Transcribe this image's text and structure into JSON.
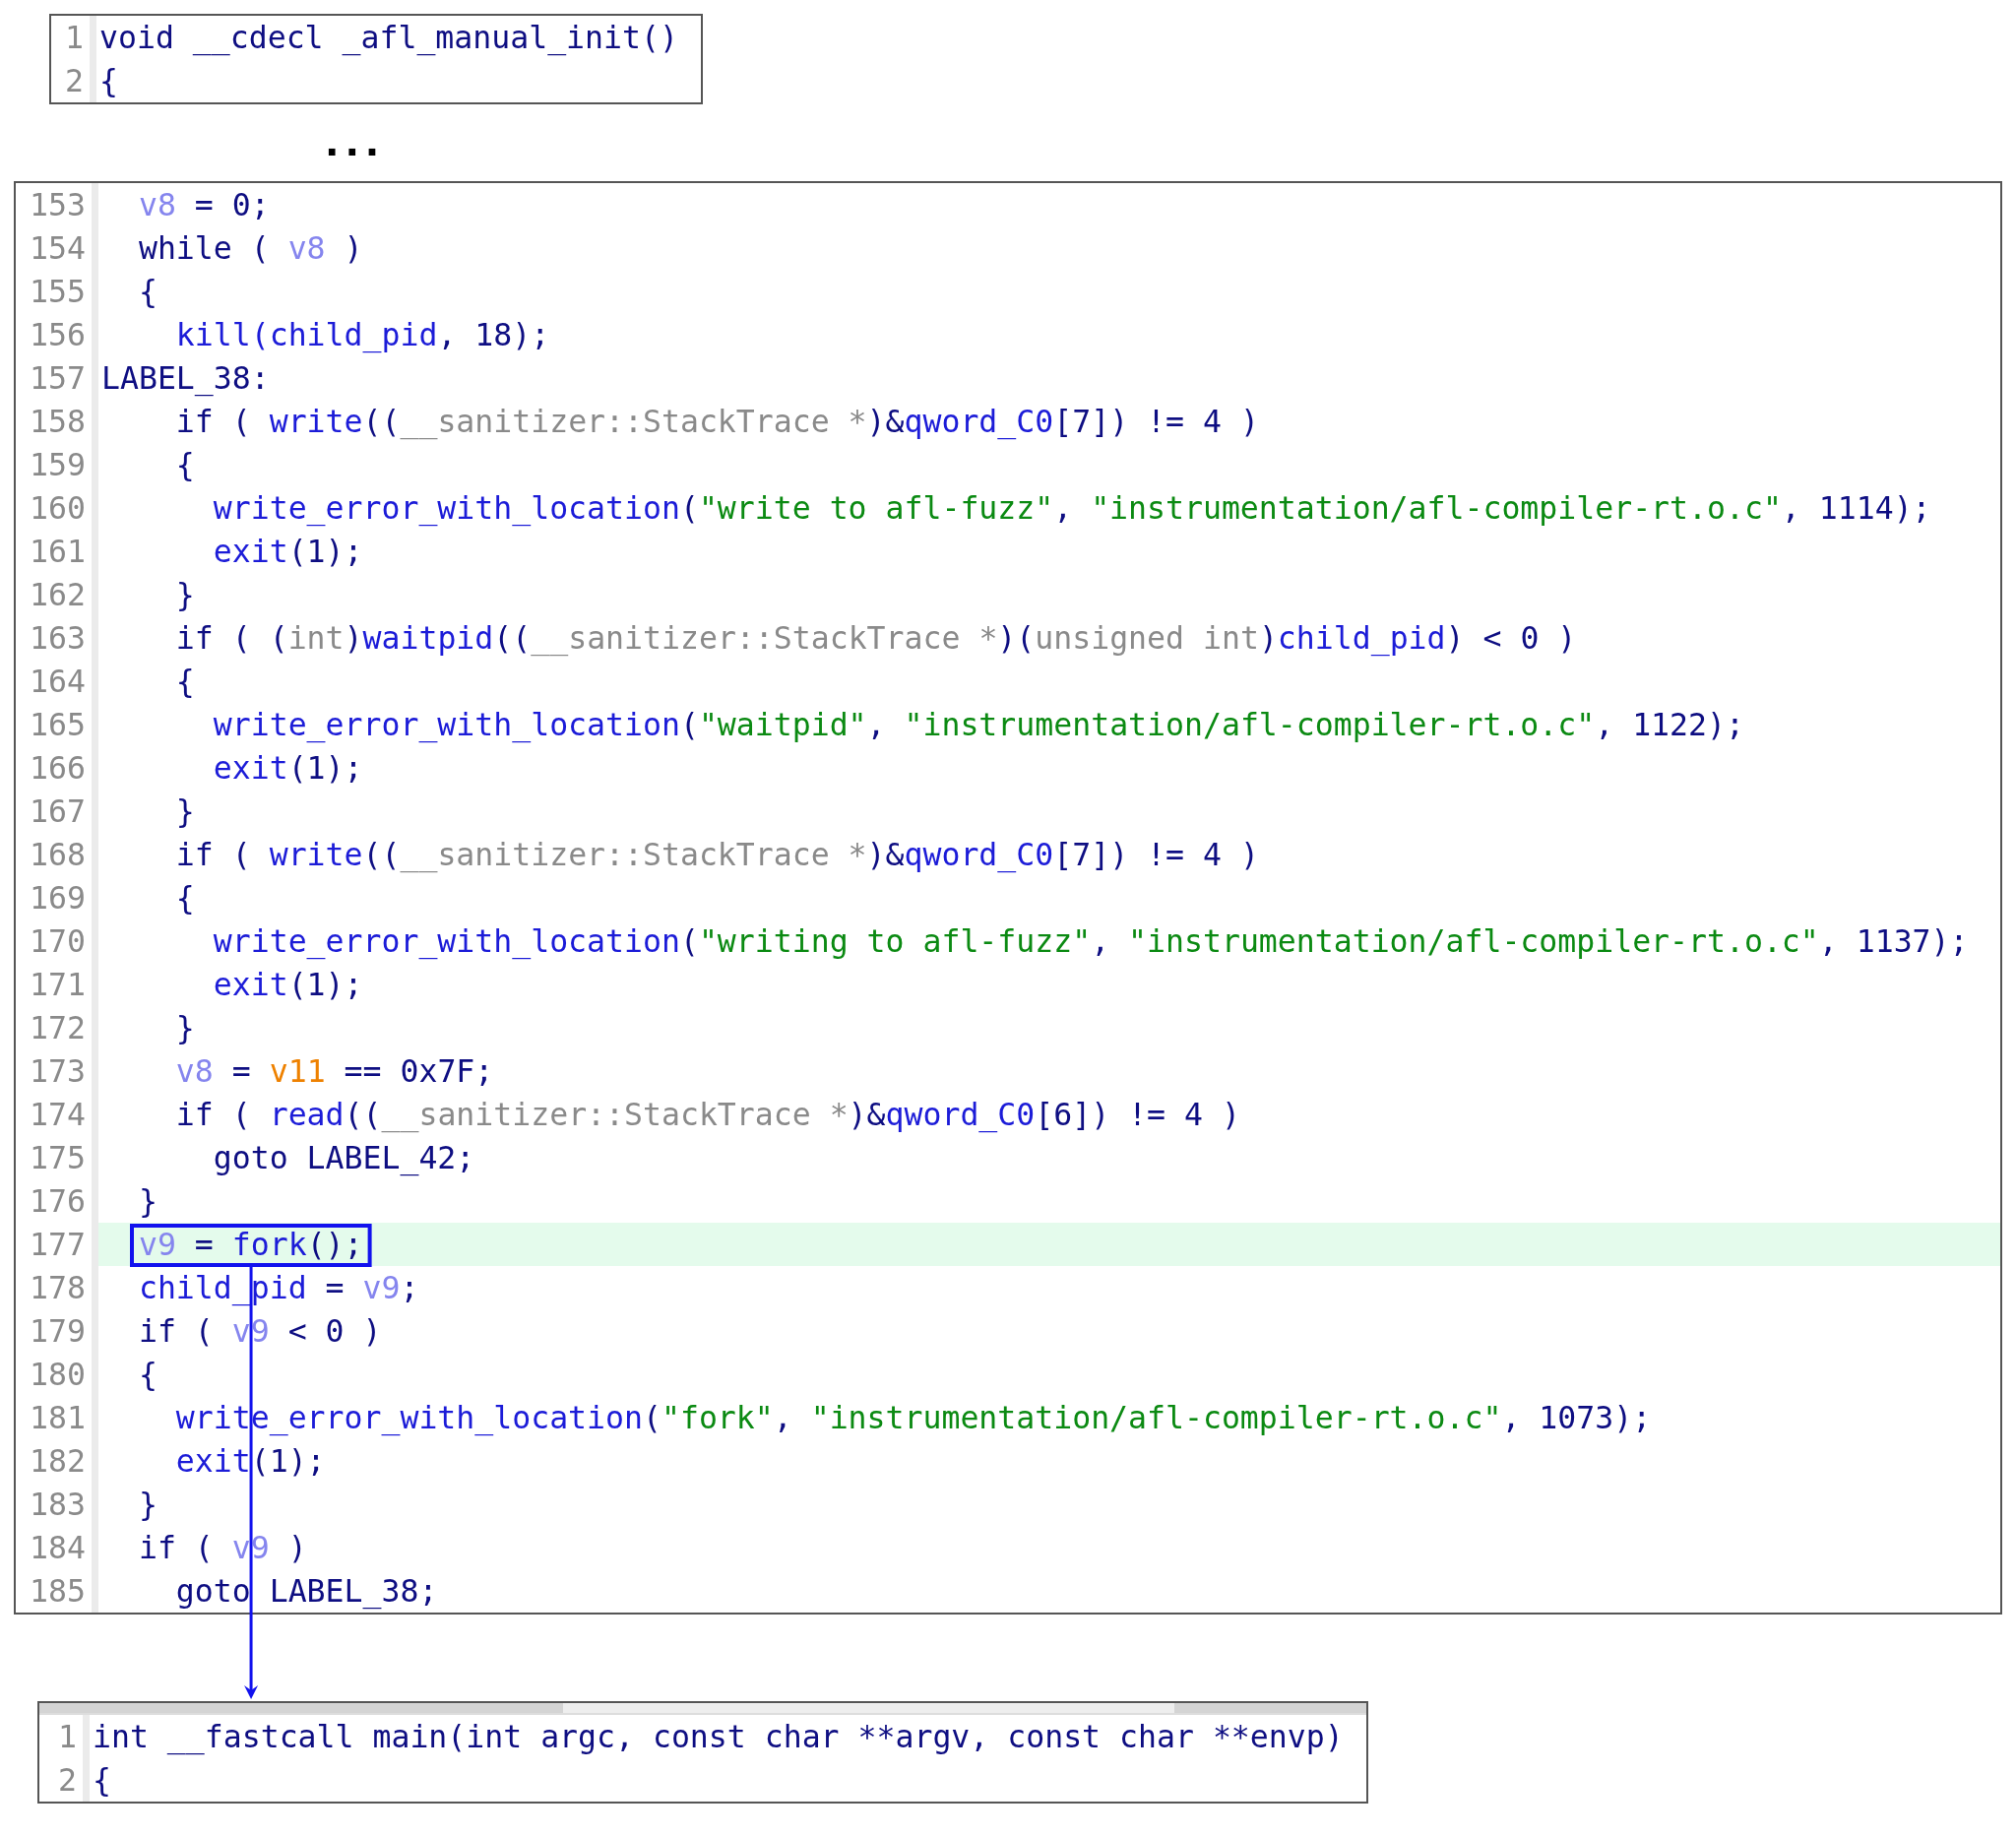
{
  "top_panel": {
    "lines": [
      {
        "number": "1",
        "selected": false,
        "tokens": [
          {
            "text": "void __cdecl _afl_manual_init()",
            "kind": "plain"
          }
        ]
      },
      {
        "number": "2",
        "selected": false,
        "tokens": [
          {
            "text": "{",
            "kind": "plain"
          }
        ]
      }
    ]
  },
  "ellipsis": "...",
  "main_panel": {
    "lines": [
      {
        "number": "153",
        "selected": false,
        "framed": false,
        "tokens": [
          {
            "text": "  v8",
            "kind": "variable"
          },
          {
            "text": " = 0;",
            "kind": "plain"
          }
        ]
      },
      {
        "number": "154",
        "selected": false,
        "framed": false,
        "tokens": [
          {
            "text": "  while ( ",
            "kind": "plain"
          },
          {
            "text": "v8",
            "kind": "variable"
          },
          {
            "text": " )",
            "kind": "plain"
          }
        ]
      },
      {
        "number": "155",
        "selected": false,
        "framed": false,
        "tokens": [
          {
            "text": "  {",
            "kind": "plain"
          }
        ]
      },
      {
        "number": "156",
        "selected": false,
        "framed": false,
        "tokens": [
          {
            "text": "    kill(child_pid",
            "kind": "function"
          },
          {
            "text": ", 18);",
            "kind": "plain"
          }
        ]
      },
      {
        "number": "157",
        "selected": false,
        "framed": false,
        "tokens": [
          {
            "text": "LABEL_38:",
            "kind": "plain"
          }
        ]
      },
      {
        "number": "158",
        "selected": false,
        "framed": false,
        "tokens": [
          {
            "text": "    if ( ",
            "kind": "plain"
          },
          {
            "text": "write",
            "kind": "function"
          },
          {
            "text": "((",
            "kind": "plain"
          },
          {
            "text": "__sanitizer::StackTrace *",
            "kind": "cast"
          },
          {
            "text": ")&",
            "kind": "plain"
          },
          {
            "text": "qword_C0",
            "kind": "function"
          },
          {
            "text": "[7]) != 4 )",
            "kind": "plain"
          }
        ]
      },
      {
        "number": "159",
        "selected": false,
        "framed": false,
        "tokens": [
          {
            "text": "    {",
            "kind": "plain"
          }
        ]
      },
      {
        "number": "160",
        "selected": false,
        "framed": false,
        "tokens": [
          {
            "text": "      write_error_with_location",
            "kind": "function"
          },
          {
            "text": "(",
            "kind": "plain"
          },
          {
            "text": "\"write to afl-fuzz\"",
            "kind": "string"
          },
          {
            "text": ", ",
            "kind": "plain"
          },
          {
            "text": "\"instrumentation/afl-compiler-rt.o.c\"",
            "kind": "string"
          },
          {
            "text": ", 1114);",
            "kind": "plain"
          }
        ]
      },
      {
        "number": "161",
        "selected": false,
        "framed": false,
        "tokens": [
          {
            "text": "      exit",
            "kind": "function"
          },
          {
            "text": "(1);",
            "kind": "plain"
          }
        ]
      },
      {
        "number": "162",
        "selected": false,
        "framed": false,
        "tokens": [
          {
            "text": "    }",
            "kind": "plain"
          }
        ]
      },
      {
        "number": "163",
        "selected": false,
        "framed": false,
        "tokens": [
          {
            "text": "    if ( (",
            "kind": "plain"
          },
          {
            "text": "int",
            "kind": "cast"
          },
          {
            "text": ")",
            "kind": "plain"
          },
          {
            "text": "waitpid",
            "kind": "function"
          },
          {
            "text": "((",
            "kind": "plain"
          },
          {
            "text": "__sanitizer::StackTrace *",
            "kind": "cast"
          },
          {
            "text": ")(",
            "kind": "plain"
          },
          {
            "text": "unsigned int",
            "kind": "cast"
          },
          {
            "text": ")",
            "kind": "plain"
          },
          {
            "text": "child_pid",
            "kind": "function"
          },
          {
            "text": ") < 0 )",
            "kind": "plain"
          }
        ]
      },
      {
        "number": "164",
        "selected": false,
        "framed": false,
        "tokens": [
          {
            "text": "    {",
            "kind": "plain"
          }
        ]
      },
      {
        "number": "165",
        "selected": false,
        "framed": false,
        "tokens": [
          {
            "text": "      write_error_with_location",
            "kind": "function"
          },
          {
            "text": "(",
            "kind": "plain"
          },
          {
            "text": "\"waitpid\"",
            "kind": "string"
          },
          {
            "text": ", ",
            "kind": "plain"
          },
          {
            "text": "\"instrumentation/afl-compiler-rt.o.c\"",
            "kind": "string"
          },
          {
            "text": ", 1122);",
            "kind": "plain"
          }
        ]
      },
      {
        "number": "166",
        "selected": false,
        "framed": false,
        "tokens": [
          {
            "text": "      exit",
            "kind": "function"
          },
          {
            "text": "(1);",
            "kind": "plain"
          }
        ]
      },
      {
        "number": "167",
        "selected": false,
        "framed": false,
        "tokens": [
          {
            "text": "    }",
            "kind": "plain"
          }
        ]
      },
      {
        "number": "168",
        "selected": false,
        "framed": false,
        "tokens": [
          {
            "text": "    if ( ",
            "kind": "plain"
          },
          {
            "text": "write",
            "kind": "function"
          },
          {
            "text": "((",
            "kind": "plain"
          },
          {
            "text": "__sanitizer::StackTrace *",
            "kind": "cast"
          },
          {
            "text": ")&",
            "kind": "plain"
          },
          {
            "text": "qword_C0",
            "kind": "function"
          },
          {
            "text": "[7]) != 4 )",
            "kind": "plain"
          }
        ]
      },
      {
        "number": "169",
        "selected": false,
        "framed": false,
        "tokens": [
          {
            "text": "    {",
            "kind": "plain"
          }
        ]
      },
      {
        "number": "170",
        "selected": false,
        "framed": false,
        "tokens": [
          {
            "text": "      write_error_with_location",
            "kind": "function"
          },
          {
            "text": "(",
            "kind": "plain"
          },
          {
            "text": "\"writing to afl-fuzz\"",
            "kind": "string"
          },
          {
            "text": ", ",
            "kind": "plain"
          },
          {
            "text": "\"instrumentation/afl-compiler-rt.o.c\"",
            "kind": "string"
          },
          {
            "text": ", 1137);",
            "kind": "plain"
          }
        ]
      },
      {
        "number": "171",
        "selected": false,
        "framed": false,
        "tokens": [
          {
            "text": "      exit",
            "kind": "function"
          },
          {
            "text": "(1);",
            "kind": "plain"
          }
        ]
      },
      {
        "number": "172",
        "selected": false,
        "framed": false,
        "tokens": [
          {
            "text": "    }",
            "kind": "plain"
          }
        ]
      },
      {
        "number": "173",
        "selected": false,
        "framed": false,
        "tokens": [
          {
            "text": "    v8",
            "kind": "variable"
          },
          {
            "text": " = ",
            "kind": "plain"
          },
          {
            "text": "v11",
            "kind": "global"
          },
          {
            "text": " == 0x7F;",
            "kind": "plain"
          }
        ]
      },
      {
        "number": "174",
        "selected": false,
        "framed": false,
        "tokens": [
          {
            "text": "    if ( ",
            "kind": "plain"
          },
          {
            "text": "read",
            "kind": "function"
          },
          {
            "text": "((",
            "kind": "plain"
          },
          {
            "text": "__sanitizer::StackTrace *",
            "kind": "cast"
          },
          {
            "text": ")&",
            "kind": "plain"
          },
          {
            "text": "qword_C0",
            "kind": "function"
          },
          {
            "text": "[6]) != 4 )",
            "kind": "plain"
          }
        ]
      },
      {
        "number": "175",
        "selected": false,
        "framed": false,
        "tokens": [
          {
            "text": "      goto LABEL_42;",
            "kind": "plain"
          }
        ]
      },
      {
        "number": "176",
        "selected": false,
        "framed": false,
        "tokens": [
          {
            "text": "  }",
            "kind": "plain"
          }
        ]
      },
      {
        "number": "177",
        "selected": true,
        "framed": true,
        "tokens": [
          {
            "text": "  v9",
            "kind": "variable"
          },
          {
            "text": " = ",
            "kind": "plain"
          },
          {
            "text": "fork",
            "kind": "function"
          },
          {
            "text": "();",
            "kind": "plain"
          }
        ]
      },
      {
        "number": "178",
        "selected": false,
        "framed": false,
        "tokens": [
          {
            "text": "  child_pid",
            "kind": "function"
          },
          {
            "text": " = ",
            "kind": "plain"
          },
          {
            "text": "v9",
            "kind": "variable"
          },
          {
            "text": ";",
            "kind": "plain"
          }
        ]
      },
      {
        "number": "179",
        "selected": false,
        "framed": false,
        "tokens": [
          {
            "text": "  if ( ",
            "kind": "plain"
          },
          {
            "text": "v9",
            "kind": "variable"
          },
          {
            "text": " < 0 )",
            "kind": "plain"
          }
        ]
      },
      {
        "number": "180",
        "selected": false,
        "framed": false,
        "tokens": [
          {
            "text": "  {",
            "kind": "plain"
          }
        ]
      },
      {
        "number": "181",
        "selected": false,
        "framed": false,
        "tokens": [
          {
            "text": "    write_error_with_location",
            "kind": "function"
          },
          {
            "text": "(",
            "kind": "plain"
          },
          {
            "text": "\"fork\"",
            "kind": "string"
          },
          {
            "text": ", ",
            "kind": "plain"
          },
          {
            "text": "\"instrumentation/afl-compiler-rt.o.c\"",
            "kind": "string"
          },
          {
            "text": ", 1073);",
            "kind": "plain"
          }
        ]
      },
      {
        "number": "182",
        "selected": false,
        "framed": false,
        "tokens": [
          {
            "text": "    exit",
            "kind": "function"
          },
          {
            "text": "(1);",
            "kind": "plain"
          }
        ]
      },
      {
        "number": "183",
        "selected": false,
        "framed": false,
        "tokens": [
          {
            "text": "  }",
            "kind": "plain"
          }
        ]
      },
      {
        "number": "184",
        "selected": false,
        "framed": false,
        "tokens": [
          {
            "text": "  if ( ",
            "kind": "plain"
          },
          {
            "text": "v9",
            "kind": "variable"
          },
          {
            "text": " )",
            "kind": "plain"
          }
        ]
      },
      {
        "number": "185",
        "selected": false,
        "framed": false,
        "tokens": [
          {
            "text": "    goto LABEL_38;",
            "kind": "plain"
          }
        ]
      }
    ]
  },
  "bottom_panel": {
    "lines": [
      {
        "number": "1",
        "selected": false,
        "tokens": [
          {
            "text": "int __fastcall main(int argc, const char **argv, const char **envp)",
            "kind": "plain"
          }
        ]
      },
      {
        "number": "2",
        "selected": false,
        "tokens": [
          {
            "text": "{",
            "kind": "plain"
          }
        ]
      }
    ]
  }
}
